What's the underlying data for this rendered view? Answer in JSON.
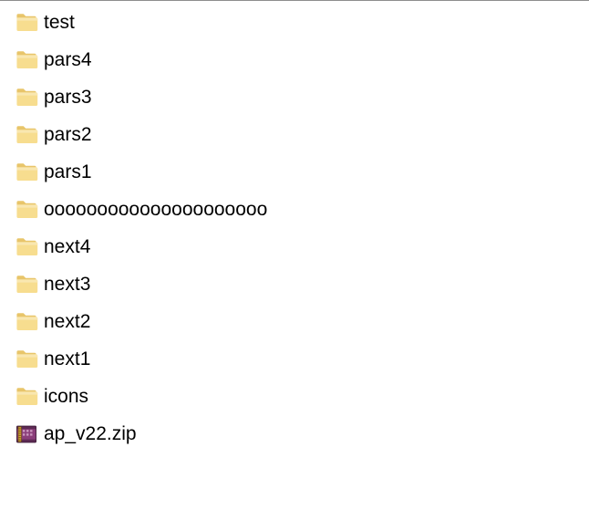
{
  "items": [
    {
      "name": "test",
      "type": "folder"
    },
    {
      "name": "pars4",
      "type": "folder"
    },
    {
      "name": "pars3",
      "type": "folder"
    },
    {
      "name": "pars2",
      "type": "folder"
    },
    {
      "name": "pars1",
      "type": "folder"
    },
    {
      "name": "ooooooooooooooooooooo",
      "type": "folder"
    },
    {
      "name": "next4",
      "type": "folder"
    },
    {
      "name": "next3",
      "type": "folder"
    },
    {
      "name": "next2",
      "type": "folder"
    },
    {
      "name": "next1",
      "type": "folder"
    },
    {
      "name": "icons",
      "type": "folder"
    },
    {
      "name": "ap_v22.zip",
      "type": "archive"
    }
  ]
}
